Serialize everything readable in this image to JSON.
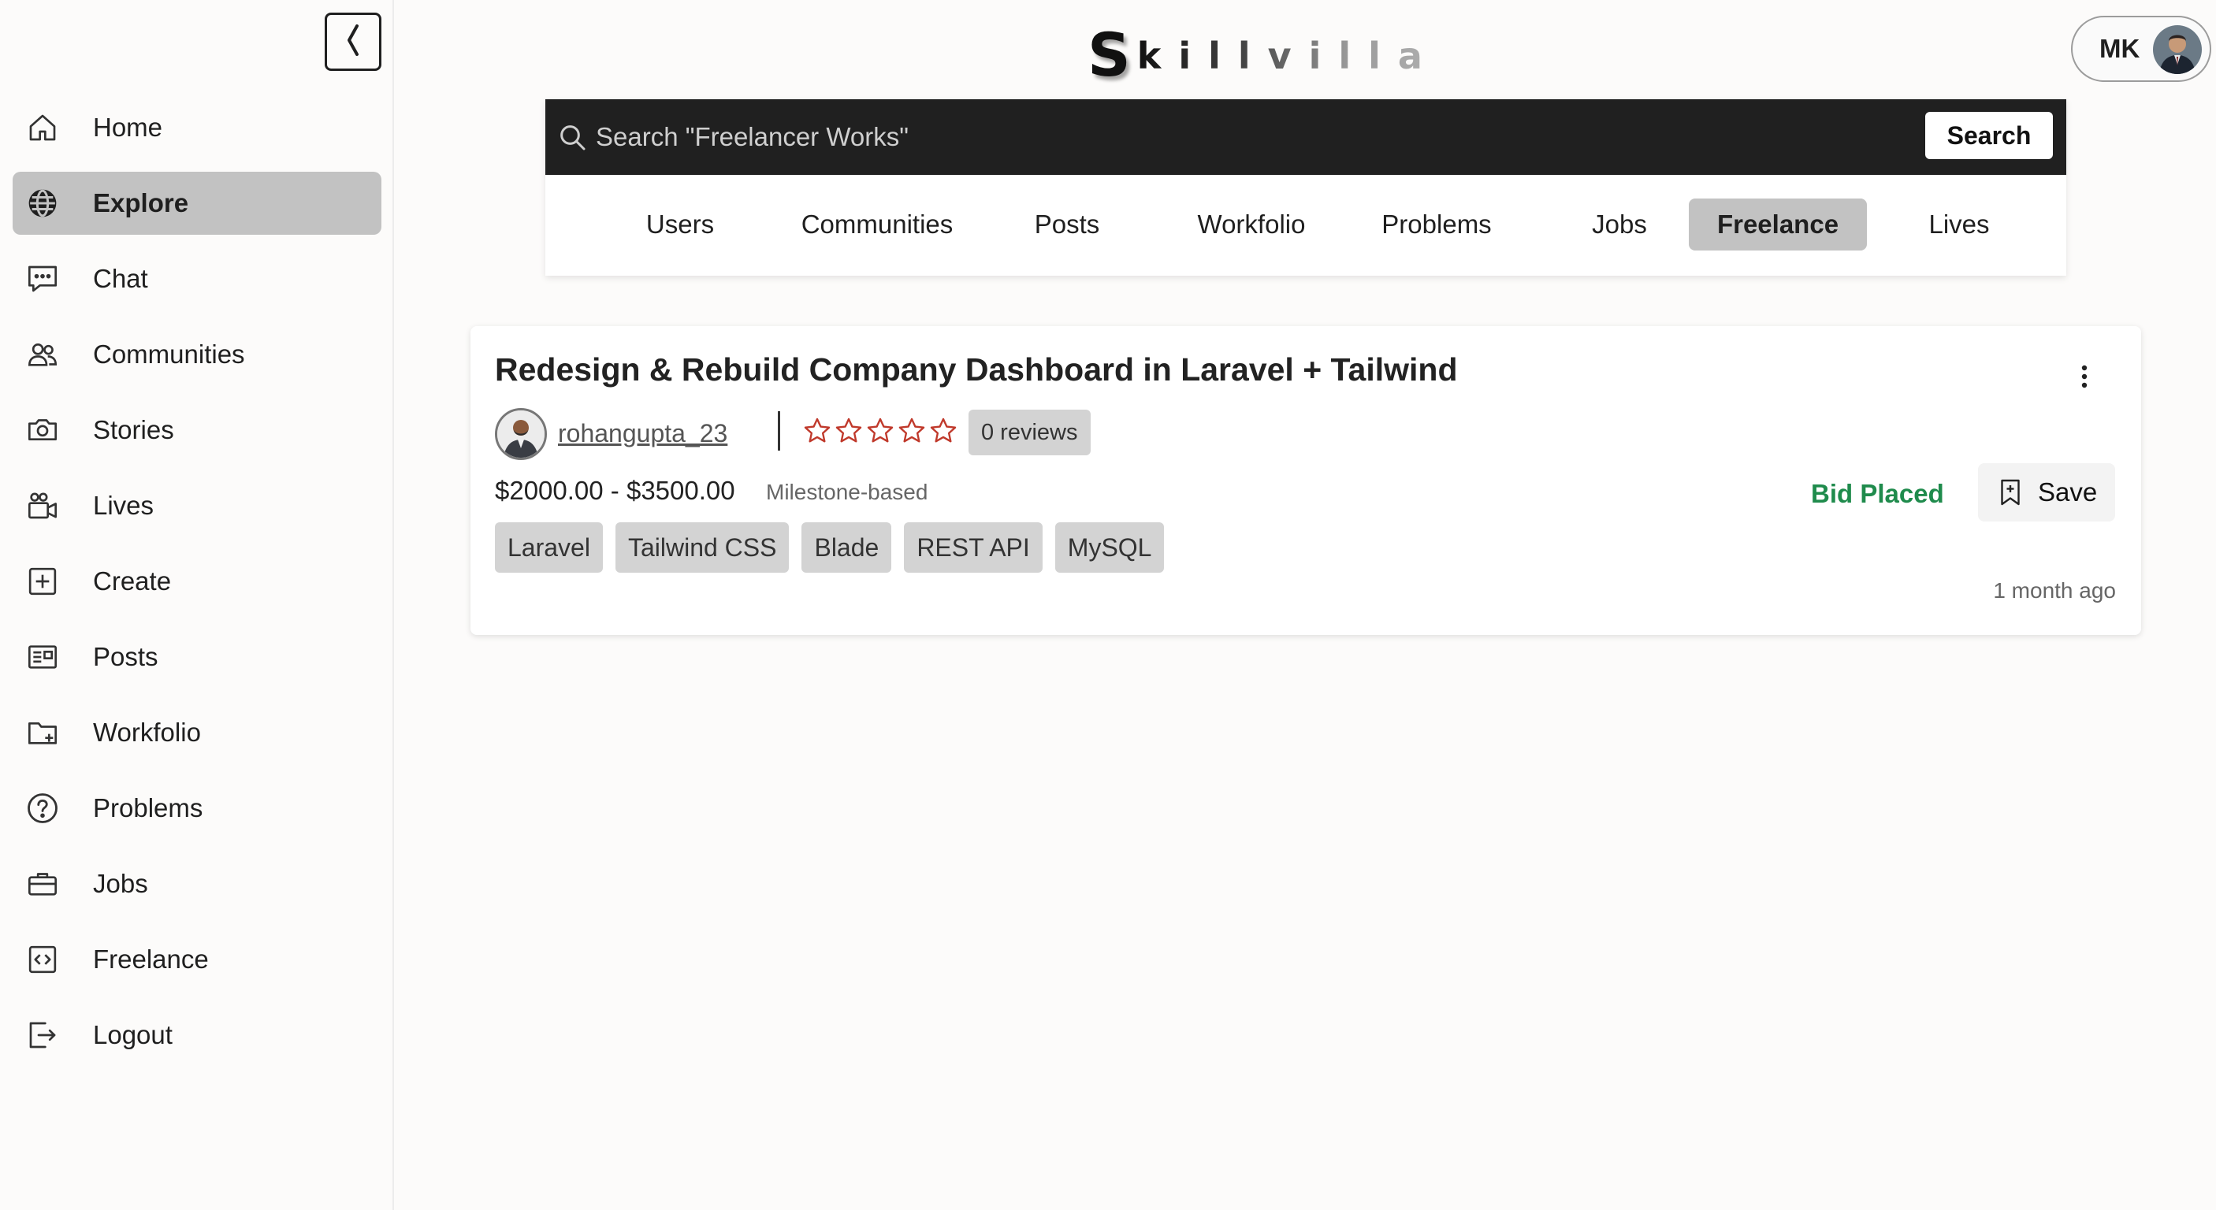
{
  "sidebar": {
    "items": [
      {
        "label": "Home",
        "icon": "home-icon",
        "active": false
      },
      {
        "label": "Explore",
        "icon": "globe-icon",
        "active": true
      },
      {
        "label": "Chat",
        "icon": "chat-icon",
        "active": false
      },
      {
        "label": "Communities",
        "icon": "users-icon",
        "active": false
      },
      {
        "label": "Stories",
        "icon": "camera-icon",
        "active": false
      },
      {
        "label": "Lives",
        "icon": "video-icon",
        "active": false
      },
      {
        "label": "Create",
        "icon": "plus-square-icon",
        "active": false
      },
      {
        "label": "Posts",
        "icon": "newspaper-icon",
        "active": false
      },
      {
        "label": "Workfolio",
        "icon": "folder-plus-icon",
        "active": false
      },
      {
        "label": "Problems",
        "icon": "help-circle-icon",
        "active": false
      },
      {
        "label": "Jobs",
        "icon": "briefcase-icon",
        "active": false
      },
      {
        "label": "Freelance",
        "icon": "code-icon",
        "active": false
      },
      {
        "label": "Logout",
        "icon": "logout-icon",
        "active": false
      }
    ]
  },
  "header": {
    "logo_first": "S",
    "logo_rest": "killvilla",
    "user_initials": "MK"
  },
  "search": {
    "placeholder": "Search \"Freelancer Works\"",
    "button_label": "Search"
  },
  "tabs": [
    {
      "label": "Users",
      "active": false
    },
    {
      "label": "Communities",
      "active": false
    },
    {
      "label": "Posts",
      "active": false
    },
    {
      "label": "Workfolio",
      "active": false
    },
    {
      "label": "Problems",
      "active": false
    },
    {
      "label": "Jobs",
      "active": false
    },
    {
      "label": "Freelance",
      "active": true
    },
    {
      "label": "Lives",
      "active": false
    }
  ],
  "job": {
    "title": "Redesign & Rebuild Company Dashboard in Laravel + Tailwind",
    "author": "rohangupta_23",
    "rating": 0,
    "rating_max": 5,
    "reviews_label": "0 reviews",
    "budget": "$2000.00 - $3500.00",
    "budget_type": "Milestone-based",
    "status": "Bid Placed",
    "save_label": "Save",
    "skills": [
      "Laravel",
      "Tailwind CSS",
      "Blade",
      "REST API",
      "MySQL"
    ],
    "posted": "1 month ago"
  },
  "colors": {
    "status_green": "#1f8b4c",
    "star_red": "#c0392b",
    "active_bg": "#c2c2c2",
    "search_bar_bg": "#202020"
  }
}
